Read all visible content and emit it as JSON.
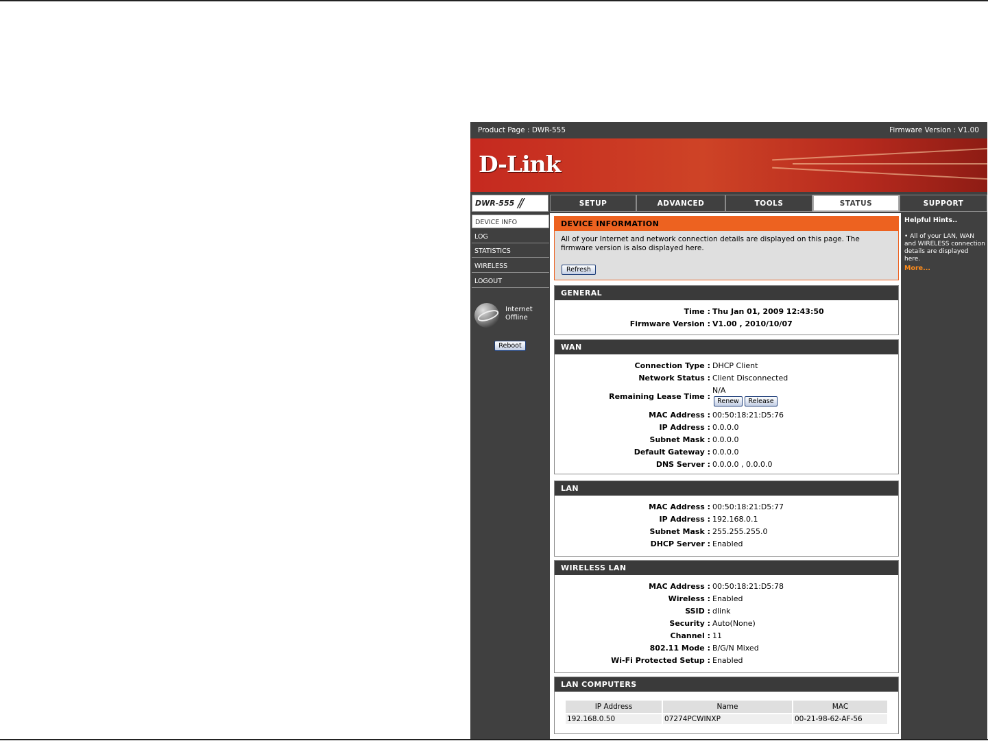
{
  "header": {
    "product_page": "Product Page :  DWR-555",
    "firmware_version": "Firmware Version : V1.00",
    "logo": "D-Link"
  },
  "nav": {
    "model": "DWR-555",
    "tabs": [
      "SETUP",
      "ADVANCED",
      "TOOLS",
      "STATUS",
      "SUPPORT"
    ],
    "active_tab": "STATUS"
  },
  "sidebar": {
    "items": [
      "DEVICE INFO",
      "LOG",
      "STATISTICS",
      "WIRELESS",
      "LOGOUT"
    ],
    "active": "DEVICE INFO",
    "internet_status": [
      "Internet",
      "Offline"
    ],
    "reboot_label": "Reboot"
  },
  "device_information": {
    "title": "DEVICE INFORMATION",
    "description": "All of your Internet and network connection details are displayed on this page. The firmware version is also displayed here.",
    "refresh_label": "Refresh"
  },
  "general": {
    "title": "GENERAL",
    "time_label": "Time :",
    "time_value": "Thu Jan 01, 2009 12:43:50",
    "firmware_label": "Firmware Version :",
    "firmware_value": "V1.00 , 2010/10/07"
  },
  "wan": {
    "title": "WAN",
    "connection_type_label": "Connection Type :",
    "connection_type": "DHCP Client",
    "network_status_label": "Network Status :",
    "network_status": "Client Disconnected",
    "lease_label": "Remaining Lease Time :",
    "lease_value": "N/A",
    "renew_label": "Renew",
    "release_label": "Release",
    "mac_label": "MAC Address :",
    "mac": "00:50:18:21:D5:76",
    "ip_label": "IP Address :",
    "ip": "0.0.0.0",
    "subnet_label": "Subnet Mask :",
    "subnet": "0.0.0.0",
    "gateway_label": "Default Gateway :",
    "gateway": "0.0.0.0",
    "dns_label": "DNS Server :",
    "dns": "0.0.0.0 , 0.0.0.0"
  },
  "lan": {
    "title": "LAN",
    "mac_label": "MAC Address :",
    "mac": "00:50:18:21:D5:77",
    "ip_label": "IP Address :",
    "ip": "192.168.0.1",
    "subnet_label": "Subnet Mask :",
    "subnet": "255.255.255.0",
    "dhcp_label": "DHCP Server :",
    "dhcp": "Enabled"
  },
  "wireless_lan": {
    "title": "WIRELESS LAN",
    "mac_label": "MAC Address :",
    "mac": "00:50:18:21:D5:78",
    "wireless_label": "Wireless :",
    "wireless": "Enabled",
    "ssid_label": "SSID :",
    "ssid": "dlink",
    "security_label": "Security :",
    "security": "Auto(None)",
    "channel_label": "Channel :",
    "channel": "11",
    "mode_label": "802.11 Mode :",
    "mode": "B/G/N Mixed",
    "wps_label": "Wi-Fi Protected Setup :",
    "wps": "Enabled"
  },
  "lan_computers": {
    "title": "LAN COMPUTERS",
    "columns": [
      "IP Address",
      "Name",
      "MAC"
    ],
    "rows": [
      [
        "192.168.0.50",
        "07274PCWINXP",
        "00-21-98-62-AF-56"
      ]
    ]
  },
  "help": {
    "title": "Helpful Hints..",
    "text": "• All of your LAN, WAN and WIRELESS connection details are displayed here.",
    "more": "More..."
  },
  "colors": {
    "frame": "#404040",
    "accent_orange": "#ed6220",
    "banner_red": "#c5291f",
    "more_link": "#ff8c1a"
  }
}
